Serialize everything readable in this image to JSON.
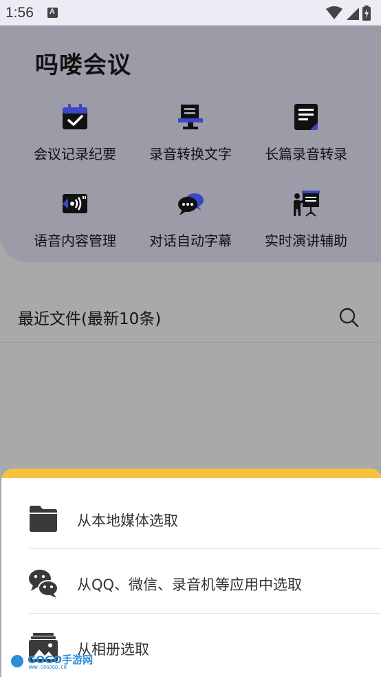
{
  "status_bar": {
    "time": "1:56",
    "notification_icon": "a-square-icon",
    "wifi_icon": "wifi-icon",
    "signal_icon": "signal-icon",
    "battery_icon": "battery-charging-icon"
  },
  "app": {
    "title": "吗喽会议"
  },
  "features": [
    {
      "label": "会议记录纪要",
      "icon": "calendar-check-icon"
    },
    {
      "label": "录音转换文字",
      "icon": "monitor-icon"
    },
    {
      "label": "长篇录音转录",
      "icon": "document-icon"
    },
    {
      "label": "语音内容管理",
      "icon": "audio-card-icon"
    },
    {
      "label": "对话自动字幕",
      "icon": "chat-bubbles-icon"
    },
    {
      "label": "实时演讲辅助",
      "icon": "presenter-icon"
    }
  ],
  "recent": {
    "title": "最近文件(最新10条)",
    "search_icon": "search-icon"
  },
  "sheet": {
    "items": [
      {
        "label": "从本地媒体选取",
        "icon": "folder-icon"
      },
      {
        "label": "从QQ、微信、录音机等应用中选取",
        "icon": "wechat-icon"
      },
      {
        "label": "从相册选取",
        "icon": "album-icon"
      }
    ]
  },
  "watermark": {
    "brand": "GOGO手游网",
    "url": "WWW.GOGOGO.CN"
  },
  "colors": {
    "accent_blue": "#3b47c4",
    "sheet_accent": "#f7c23c",
    "panel": "#9b9ca8",
    "scrim": "#a9a9ac"
  }
}
